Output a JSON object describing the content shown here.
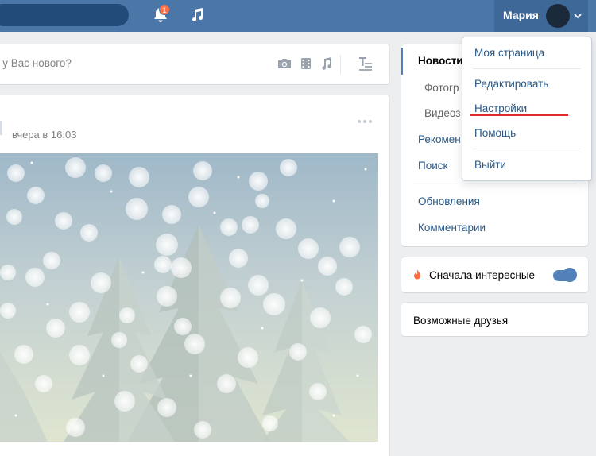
{
  "header": {
    "notification_count": "1",
    "user_name": "Мария"
  },
  "compose": {
    "placeholder": "о у Вас нового?"
  },
  "post": {
    "time": "вчера в 16:03"
  },
  "nav": {
    "items": [
      {
        "label": "Новости",
        "state": "active"
      },
      {
        "label": "Фотогр",
        "state": "sub"
      },
      {
        "label": "Видеоз",
        "state": "sub"
      },
      {
        "label": "Рекомен",
        "state": "normal"
      },
      {
        "label": "Поиск",
        "state": "normal"
      },
      {
        "label": "Обновления",
        "state": "normal"
      },
      {
        "label": "Комментарии",
        "state": "normal"
      }
    ]
  },
  "interest": {
    "label": "Сначала интересные",
    "toggle_on": true
  },
  "friends": {
    "label": "Возможные друзья"
  },
  "dropdown": {
    "items": [
      {
        "label": "Моя страница"
      },
      {
        "label": "Редактировать"
      },
      {
        "label": "Настройки",
        "highlighted": true
      },
      {
        "label": "Помощь"
      },
      {
        "label": "Выйти"
      }
    ]
  },
  "colors": {
    "topbar": "#4a76a8",
    "link": "#2a5885",
    "accent": "#5181b8",
    "underline": "#e02a2a",
    "badge": "#ff734c"
  },
  "icons": [
    "bell-icon",
    "music-icon",
    "chevron-down-icon",
    "camera-icon",
    "video-icon",
    "audio-icon",
    "text-format-icon",
    "more-icon",
    "flame-icon"
  ]
}
